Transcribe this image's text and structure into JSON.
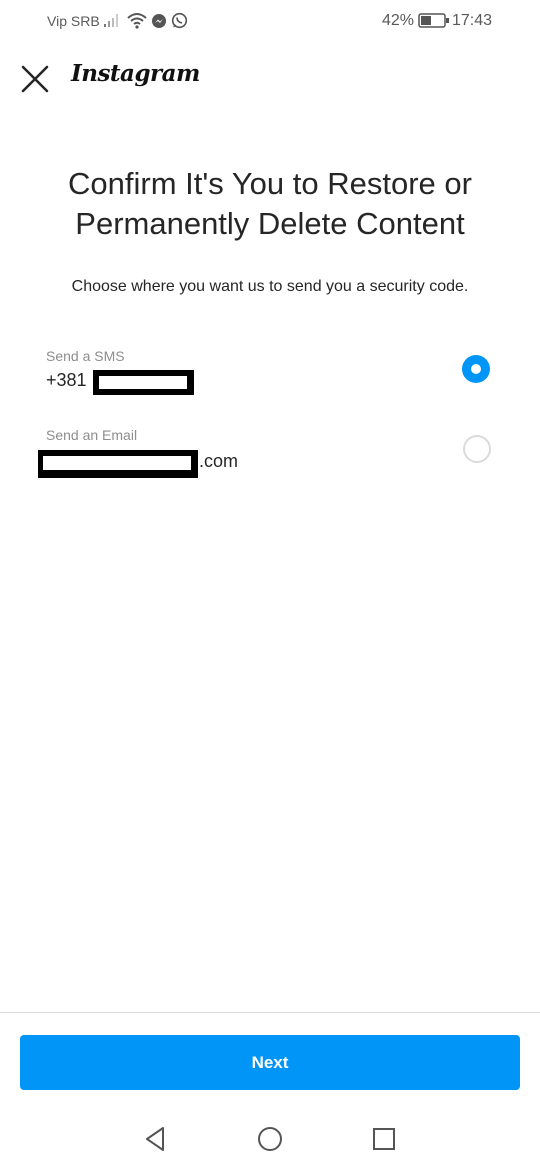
{
  "status_bar": {
    "carrier": "Vip SRB",
    "battery_percent": "42%",
    "time": "17:43"
  },
  "header": {
    "close_icon": "close-icon",
    "logo_text": "Instagram"
  },
  "main": {
    "title_line1": "Confirm It's You to Restore or",
    "title_line2": "Permanently Delete Content",
    "subtitle": "Choose where you want us to send you a security code.",
    "options": [
      {
        "label": "Send a SMS",
        "value": "+381",
        "selected": true
      },
      {
        "label": "Send an Email",
        "value": ".com",
        "selected": false
      }
    ]
  },
  "footer": {
    "next_label": "Next"
  },
  "colors": {
    "accent": "#0095f6",
    "text": "#262626",
    "secondary_text": "#8e8e8e"
  },
  "nav_bar": {
    "icons": [
      "back-icon",
      "home-icon",
      "recents-icon"
    ]
  }
}
